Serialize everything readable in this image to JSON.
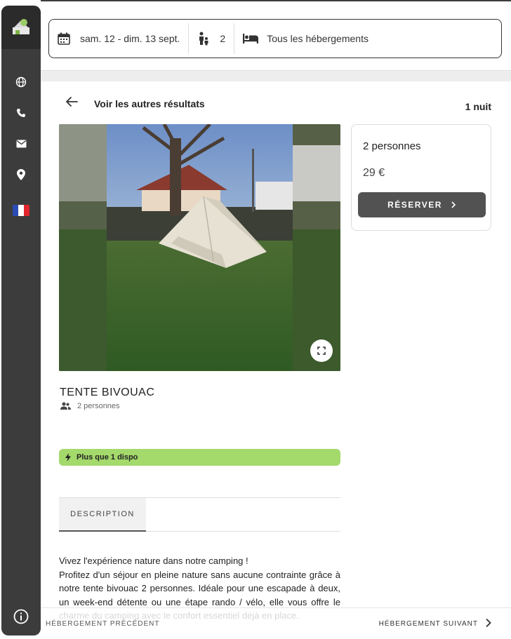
{
  "search": {
    "dates": "sam. 12 - dim. 13 sept.",
    "guests": "2",
    "accommodation": "Tous les hébergements"
  },
  "nav": {
    "back_label": "Voir les autres résultats",
    "nights": "1 nuit"
  },
  "booking": {
    "persons": "2 personnes",
    "price": "29 €",
    "reserve_label": "RÉSERVER"
  },
  "accommodation": {
    "title": "TENTE BIVOUAC",
    "capacity": "2 personnes",
    "availability": "Plus que 1 dispo"
  },
  "tabs": {
    "description": "DESCRIPTION"
  },
  "description": {
    "line1": "Vivez l'expérience nature dans notre camping !",
    "body": "Profitez d'un séjour en pleine nature sans aucune contrainte grâce à notre tente bivouac 2 personnes.  Idéale pour une escapade à deux, un week-end détente ou une étape rando / vélo, elle vous offre le charme du camping avec le confort essentiel déjà en place."
  },
  "footer": {
    "prev_label": "HÉBERGEMENT PRÉCÉDENT",
    "next_label": "HÉBERGEMENT SUIVANT"
  },
  "sidebar": {
    "icons": [
      "globe-icon",
      "phone-icon",
      "mail-icon",
      "location-pin-icon",
      "french-flag-icon",
      "info-icon"
    ]
  },
  "colors": {
    "sidebar": "#3c3c3c",
    "accent_button": "#525252",
    "availability_badge": "#a4d96c"
  }
}
